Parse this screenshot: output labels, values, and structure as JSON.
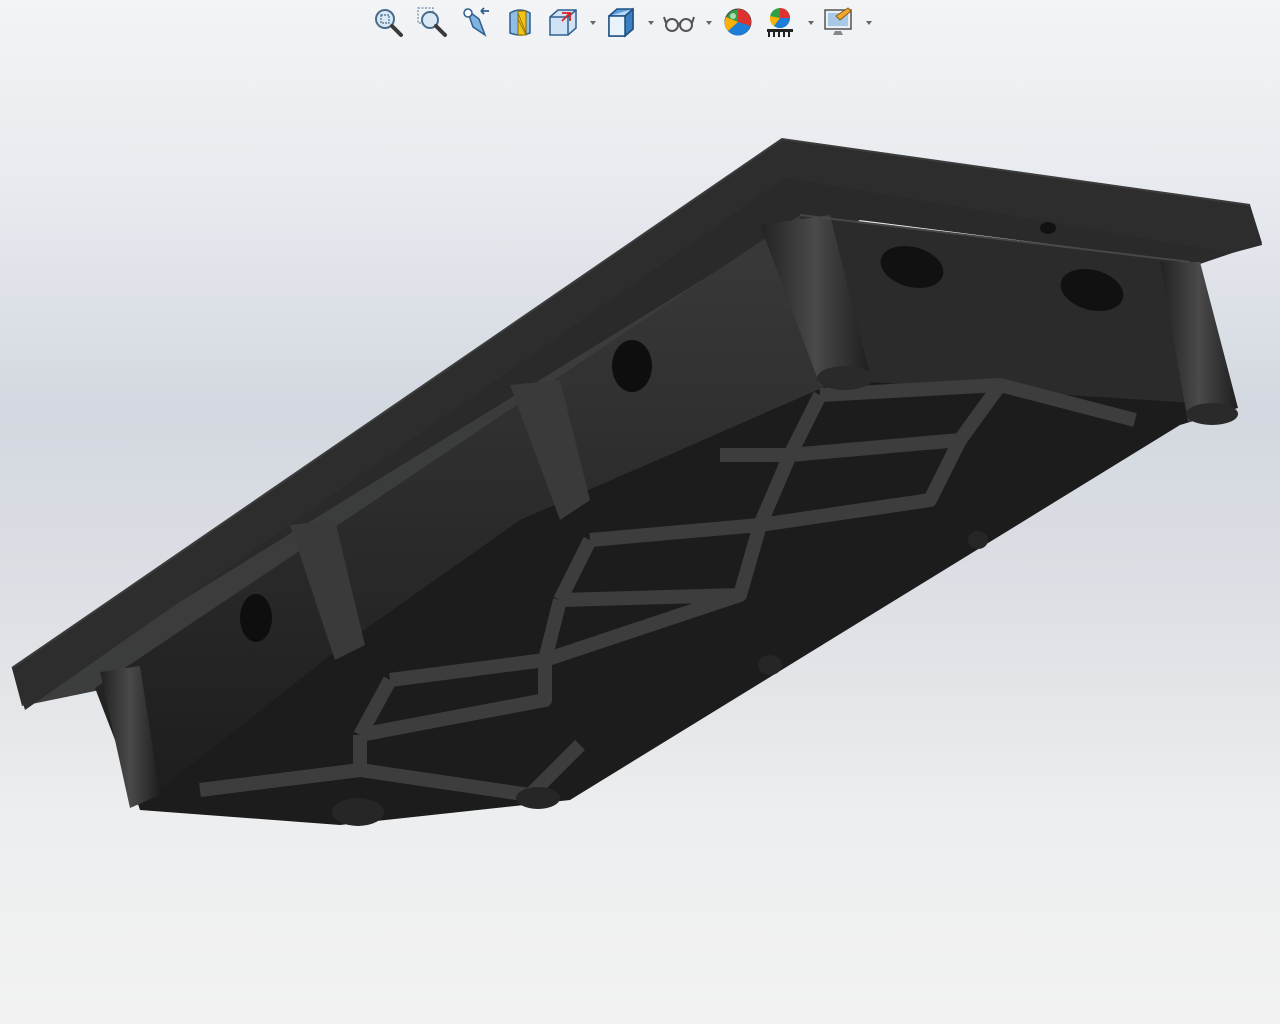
{
  "app": {
    "view": "3d-graphics-area"
  },
  "hud_toolbar": {
    "items": [
      {
        "name": "zoom-to-fit-icon",
        "has_dropdown": false
      },
      {
        "name": "zoom-to-area-icon",
        "has_dropdown": false
      },
      {
        "name": "previous-view-icon",
        "has_dropdown": false
      },
      {
        "name": "section-view-icon",
        "has_dropdown": false
      },
      {
        "name": "view-orientation-icon",
        "has_dropdown": true
      },
      {
        "name": "display-style-icon",
        "has_dropdown": true
      },
      {
        "name": "hide-show-items-icon",
        "has_dropdown": true
      },
      {
        "name": "edit-appearance-icon",
        "has_dropdown": false
      },
      {
        "name": "apply-scene-icon",
        "has_dropdown": true
      },
      {
        "name": "view-settings-icon",
        "has_dropdown": true
      }
    ]
  },
  "colors": {
    "model_dark": "#1e1e1e",
    "model_mid": "#2c2c2c",
    "model_light": "#3a3a3a",
    "background_top": "#f3f4f6",
    "background_mid": "#d3d8e0"
  },
  "model": {
    "type": "ribbed-base-plate"
  }
}
